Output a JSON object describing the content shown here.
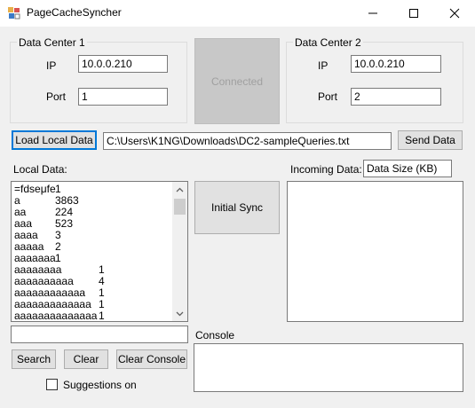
{
  "window": {
    "title": "PageCacheSyncher",
    "minimize_glyph": "—",
    "maximize_glyph": "☐",
    "close_glyph": "✕"
  },
  "dc1": {
    "title": "Data Center 1",
    "ip_label": "IP",
    "ip_value": "10.0.0.210",
    "port_label": "Port",
    "port_value": "1"
  },
  "dc2": {
    "title": "Data Center 2",
    "ip_label": "IP",
    "ip_value": "10.0.0.210",
    "port_label": "Port",
    "port_value": "2"
  },
  "status": {
    "connected_label": "Connected"
  },
  "file": {
    "load_label": "Load Local Data",
    "path_value": "C:\\Users\\K1NG\\Downloads\\DC2-sampleQueries.txt",
    "send_label": "Send Data"
  },
  "local": {
    "label": "Local Data:",
    "items": [
      {
        "key": "=fdseμfe",
        "value": "1"
      },
      {
        "key": "a",
        "value": "3863"
      },
      {
        "key": "aa",
        "value": "224"
      },
      {
        "key": "aaa",
        "value": "523"
      },
      {
        "key": "aaaa",
        "value": "3"
      },
      {
        "key": "aaaaa",
        "value": "2"
      },
      {
        "key": "aaaaaaa",
        "value": "1"
      },
      {
        "key": "aaaaaaaa",
        "value": "1"
      },
      {
        "key": "aaaaaaaaaa",
        "value": "4"
      },
      {
        "key": "aaaaaaaaaaaa",
        "value": "1"
      },
      {
        "key": "aaaaaaaaaaaaa",
        "value": "1"
      },
      {
        "key": "aaaaaaaaaaaaaa",
        "value": "1"
      }
    ],
    "scroll_up": "▲",
    "scroll_down": "▼"
  },
  "sync": {
    "initial_label": "Initial Sync"
  },
  "incoming": {
    "label": "Incoming Data:",
    "size_value": "Data Size (KB)"
  },
  "search": {
    "input_value": "",
    "search_label": "Search",
    "clear_label": "Clear",
    "clear_console_label": "Clear Console",
    "suggestions_label": "Suggestions on"
  },
  "console": {
    "label": "Console"
  }
}
